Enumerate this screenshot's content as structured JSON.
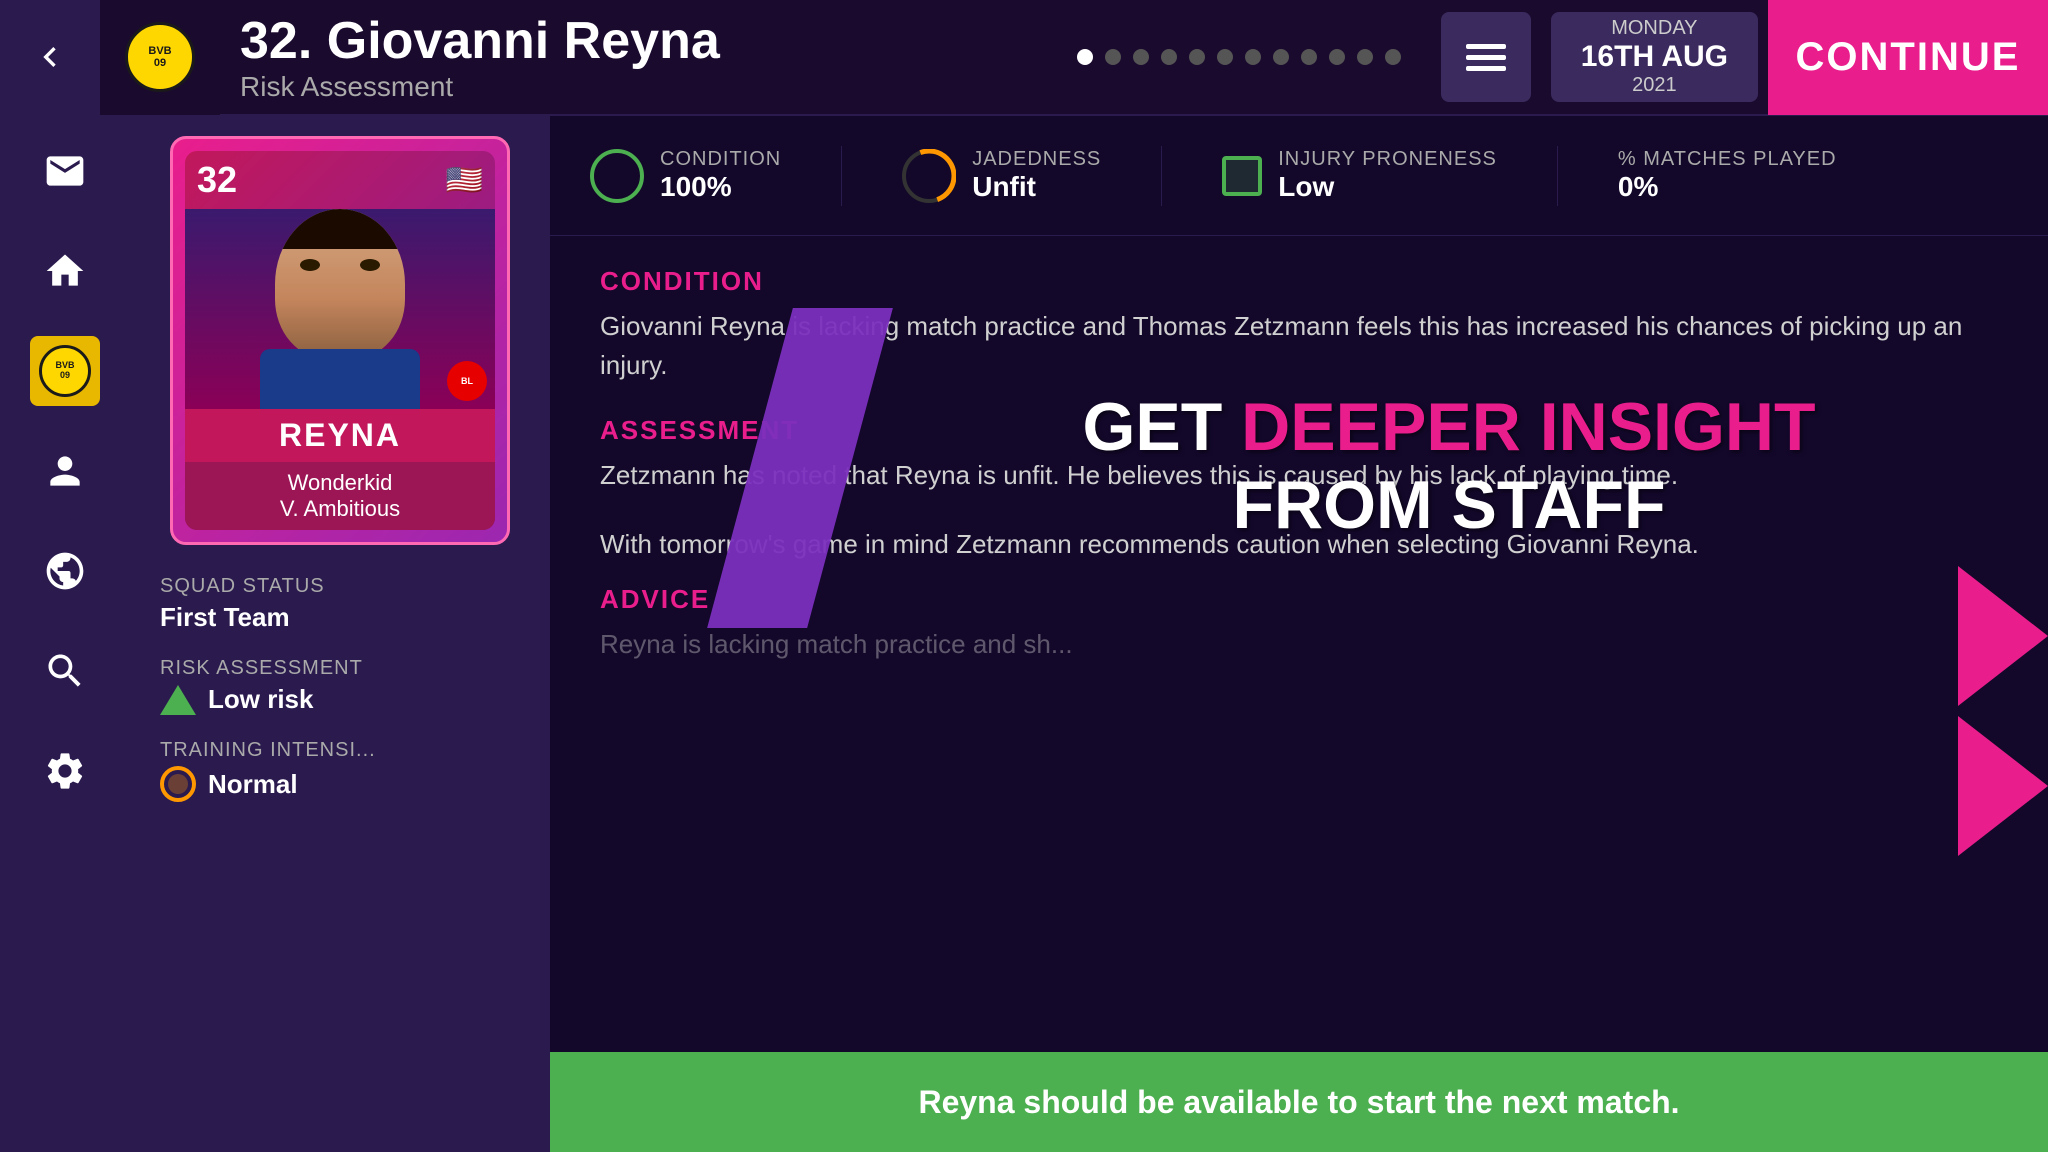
{
  "topbar": {
    "back_label": "‹",
    "player_number": "32.",
    "player_name": "Giovanni Reyna",
    "section": "Risk Assessment",
    "menu_label": "Menu",
    "date": {
      "day": "MONDAY",
      "date": "16TH AUG",
      "year": "2021"
    },
    "continue_label": "CONTINUE"
  },
  "pagination": {
    "total": 12,
    "active": 0
  },
  "stats": {
    "condition": {
      "label": "CONDITION",
      "value": "100%",
      "indicator": "green"
    },
    "jadedness": {
      "label": "JADEDNESS",
      "value": "Unfit",
      "indicator": "yellow"
    },
    "injury_proneness": {
      "label": "INJURY PRONENESS",
      "value": "Low",
      "indicator": "small"
    },
    "matches_played": {
      "label": "% MATCHES PLAYED",
      "value": "0%"
    }
  },
  "condition_section": {
    "label": "CONDITION",
    "text": "Giovanni Reyna is lacking match practice and Thomas Zetzmann feels this has increased his chances of picking up an injury."
  },
  "assessment_section": {
    "label": "ASSESSMENT",
    "text": "Zetzmann has noted that Reyna is unfit. He believes this is caused by his lack of playing time."
  },
  "follow_text": "With tomorrow's game in mind Zetzmann recommends caution when selecting Giovanni Reyna.",
  "advice_section": {
    "label": "ADVICE",
    "text": "Reyna is lacking match practice and sh..."
  },
  "promo": {
    "line1_white": "GET ",
    "line1_pink": "DEEPER INSIGHT",
    "line2": "FROM STAFF"
  },
  "player_card": {
    "number": "32",
    "flag": "🇺🇸",
    "name": "REYNA",
    "trait1": "Wonderkid",
    "trait2": "V. Ambitious"
  },
  "sidebar_items": [
    {
      "id": "mail",
      "label": "Mail",
      "active": false
    },
    {
      "id": "home",
      "label": "Home",
      "active": false
    },
    {
      "id": "club",
      "label": "Club",
      "active": true
    },
    {
      "id": "manager",
      "label": "Manager",
      "active": false
    },
    {
      "id": "world",
      "label": "World",
      "active": false
    },
    {
      "id": "search",
      "label": "Search",
      "active": false
    },
    {
      "id": "settings",
      "label": "Settings",
      "active": false
    }
  ],
  "player_info": {
    "squad_status_label": "SQUAD STATUS",
    "squad_status_value": "First Team",
    "risk_label": "RISK ASSESSMENT",
    "risk_value": "Low risk",
    "training_label": "TRAINING INTENSI...",
    "training_value": "Normal"
  },
  "recommendation": {
    "text": "Reyna should be available to start the next match."
  }
}
